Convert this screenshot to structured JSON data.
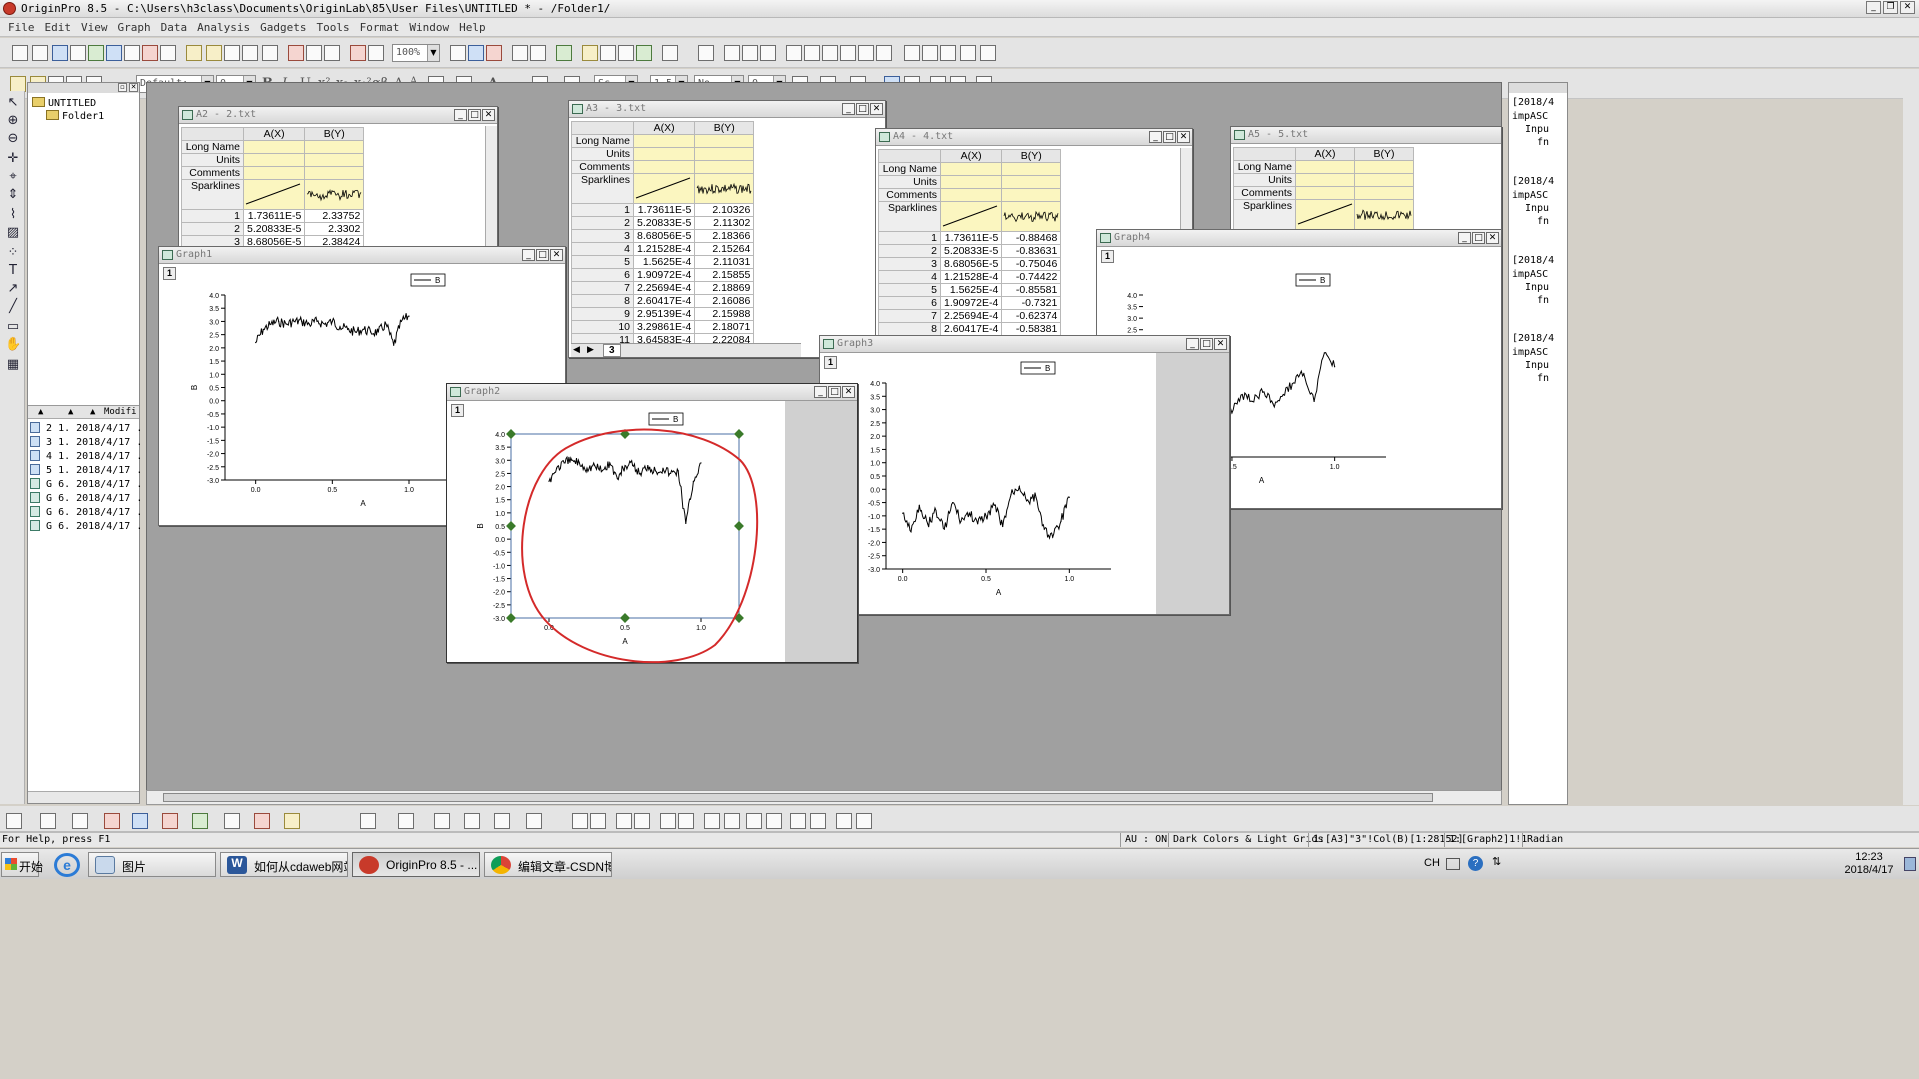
{
  "app": {
    "title": "OriginPro 8.5 - C:\\Users\\h3class\\Documents\\OriginLab\\85\\User Files\\UNTITLED * - /Folder1/"
  },
  "menu": [
    "File",
    "Edit",
    "View",
    "Graph",
    "Data",
    "Analysis",
    "Gadgets",
    "Tools",
    "Format",
    "Window",
    "Help"
  ],
  "toolbar": {
    "zoom": "100%",
    "font_name": "Default:",
    "font_size": "0",
    "bold": "B",
    "italic": "I",
    "underline": "U",
    "superscript": "x²",
    "subscript": "x₂",
    "supersub": "x₁²",
    "greek": "αβ",
    "larger_font": "A",
    "smaller_font": "A",
    "text_color": "A",
    "line_style": "Sc",
    "line_width": "1.5",
    "pattern": "No",
    "pattern_size": "0"
  },
  "explorer": {
    "root": "UNTITLED",
    "folder": "Folder1",
    "columns": {
      "modified": "Modifi"
    },
    "files": [
      {
        "type": "book",
        "id": "2",
        "view": "1.",
        "date": "2018/4/17 ."
      },
      {
        "type": "book",
        "id": "3",
        "view": "1.",
        "date": "2018/4/17 ."
      },
      {
        "type": "book",
        "id": "4",
        "view": "1.",
        "date": "2018/4/17 ."
      },
      {
        "type": "book",
        "id": "5",
        "view": "1.",
        "date": "2018/4/17 ."
      },
      {
        "type": "graph",
        "id": "G",
        "view": "6.",
        "date": "2018/4/17 ."
      },
      {
        "type": "graph",
        "id": "G",
        "view": "6.",
        "date": "2018/4/17 ."
      },
      {
        "type": "graph",
        "id": "G",
        "view": "6.",
        "date": "2018/4/17 ."
      },
      {
        "type": "graph",
        "id": "G",
        "view": "6.",
        "date": "2018/4/17 ."
      }
    ]
  },
  "sheet_labels": {
    "col_a": "A(X)",
    "col_b": "B(Y)",
    "long_name": "Long Name",
    "units": "Units",
    "comments": "Comments",
    "sparklines": "Sparklines"
  },
  "worksheets": {
    "a2": {
      "title": "A2 - 2.txt",
      "rows": [
        {
          "n": "1",
          "a": "1.73611E-5",
          "b": "2.33752"
        },
        {
          "n": "2",
          "a": "5.20833E-5",
          "b": "2.3302"
        },
        {
          "n": "3",
          "a": "8.68056E-5",
          "b": "2.38424"
        }
      ]
    },
    "a3": {
      "title": "A3 - 3.txt",
      "sheet_tab": "3",
      "rows": [
        {
          "n": "1",
          "a": "1.73611E-5",
          "b": "2.10326"
        },
        {
          "n": "2",
          "a": "5.20833E-5",
          "b": "2.11302"
        },
        {
          "n": "3",
          "a": "8.68056E-5",
          "b": "2.18366"
        },
        {
          "n": "4",
          "a": "1.21528E-4",
          "b": "2.15264"
        },
        {
          "n": "5",
          "a": "1.5625E-4",
          "b": "2.11031"
        },
        {
          "n": "6",
          "a": "1.90972E-4",
          "b": "2.15855"
        },
        {
          "n": "7",
          "a": "2.25694E-4",
          "b": "2.18869"
        },
        {
          "n": "8",
          "a": "2.60417E-4",
          "b": "2.16086"
        },
        {
          "n": "9",
          "a": "2.95139E-4",
          "b": "2.15988"
        },
        {
          "n": "10",
          "a": "3.29861E-4",
          "b": "2.18071"
        },
        {
          "n": "11",
          "a": "3.64583E-4",
          "b": "2.22084"
        }
      ]
    },
    "a4": {
      "title": "A4 - 4.txt",
      "rows": [
        {
          "n": "1",
          "a": "1.73611E-5",
          "b": "-0.88468"
        },
        {
          "n": "2",
          "a": "5.20833E-5",
          "b": "-0.83631"
        },
        {
          "n": "3",
          "a": "8.68056E-5",
          "b": "-0.75046"
        },
        {
          "n": "4",
          "a": "1.21528E-4",
          "b": "-0.74422"
        },
        {
          "n": "5",
          "a": "1.5625E-4",
          "b": "-0.85581"
        },
        {
          "n": "6",
          "a": "1.90972E-4",
          "b": "-0.7321"
        },
        {
          "n": "7",
          "a": "2.25694E-4",
          "b": "-0.62374"
        },
        {
          "n": "8",
          "a": "2.60417E-4",
          "b": "-0.58381"
        }
      ]
    },
    "a5": {
      "title": "A5 - 5.txt",
      "rows": []
    }
  },
  "graphs": {
    "graph1": {
      "title": "Graph1",
      "layer": "1",
      "legend": "B",
      "xlabel": "A",
      "ylabel": "B"
    },
    "graph2": {
      "title": "Graph2",
      "layer": "1",
      "legend": "B",
      "xlabel": "A",
      "ylabel": "B"
    },
    "graph3": {
      "title": "Graph3",
      "layer": "1",
      "legend": "B",
      "xlabel": "A",
      "ylabel": "B"
    },
    "graph4": {
      "title": "Graph4",
      "layer": "1",
      "legend": "B",
      "xlabel": "A",
      "ylabel": "B"
    }
  },
  "chart_data": [
    {
      "name": "Graph1",
      "type": "line",
      "xlim": [
        -0.2,
        1.6
      ],
      "ylim": [
        -3.0,
        4.0
      ],
      "xticks": [
        "0.0",
        "0.5",
        "1.0"
      ],
      "yticks": [
        "-3.0",
        "-2.5",
        "-2.0",
        "-1.5",
        "-1.0",
        "-0.5",
        "0.0",
        "0.5",
        "1.0",
        "1.5",
        "2.0",
        "2.5",
        "3.0",
        "3.5",
        "4.0"
      ],
      "x": [
        0.0,
        0.05,
        0.1,
        0.15,
        0.2,
        0.25,
        0.3,
        0.35,
        0.4,
        0.45,
        0.5,
        0.55,
        0.6,
        0.65,
        0.7,
        0.75,
        0.8,
        0.85,
        0.9,
        0.95,
        1.0
      ],
      "y": [
        2.2,
        2.7,
        2.9,
        3.0,
        2.9,
        3.0,
        3.0,
        2.9,
        3.0,
        2.9,
        3.0,
        2.8,
        2.7,
        2.6,
        2.7,
        2.6,
        2.6,
        2.9,
        2.1,
        3.0,
        3.2
      ]
    },
    {
      "name": "Graph2",
      "type": "line",
      "xlim": [
        -0.25,
        1.25
      ],
      "ylim": [
        -3.0,
        4.0
      ],
      "xticks": [
        "0.0",
        "0.5",
        "1.0"
      ],
      "yticks": [
        "-3.0",
        "-2.5",
        "-2.0",
        "-1.5",
        "-1.0",
        "-0.5",
        "0.0",
        "0.5",
        "1.0",
        "1.5",
        "2.0",
        "2.5",
        "3.0",
        "3.5",
        "4.0"
      ],
      "x": [
        0.0,
        0.05,
        0.1,
        0.15,
        0.2,
        0.25,
        0.3,
        0.35,
        0.4,
        0.45,
        0.5,
        0.55,
        0.6,
        0.65,
        0.7,
        0.75,
        0.8,
        0.85,
        0.9,
        0.95,
        1.0
      ],
      "y": [
        2.2,
        2.7,
        2.9,
        3.0,
        2.9,
        2.7,
        2.8,
        2.6,
        2.9,
        2.3,
        2.8,
        2.8,
        2.5,
        2.8,
        2.6,
        2.7,
        2.5,
        2.6,
        0.6,
        2.2,
        2.9
      ]
    },
    {
      "name": "Graph3",
      "type": "line",
      "xlim": [
        -0.1,
        1.25
      ],
      "ylim": [
        -3.0,
        4.0
      ],
      "xticks": [
        "0.0",
        "0.5",
        "1.0"
      ],
      "yticks": [
        "-3.0",
        "-2.5",
        "-2.0",
        "-1.5",
        "-1.0",
        "-0.5",
        "0.0",
        "0.5",
        "1.0",
        "1.5",
        "2.0",
        "2.5",
        "3.0",
        "3.5",
        "4.0"
      ],
      "x": [
        0.0,
        0.05,
        0.1,
        0.15,
        0.2,
        0.25,
        0.3,
        0.35,
        0.4,
        0.45,
        0.5,
        0.55,
        0.6,
        0.65,
        0.7,
        0.75,
        0.8,
        0.85,
        0.9,
        0.95,
        1.0
      ],
      "y": [
        -0.9,
        -1.6,
        -0.6,
        -1.3,
        -0.8,
        -1.5,
        -0.5,
        -1.2,
        -0.9,
        -1.3,
        -1.0,
        -0.6,
        -1.4,
        -0.2,
        0.1,
        -0.4,
        -0.3,
        -1.5,
        -1.8,
        -1.2,
        -0.3
      ]
    },
    {
      "name": "Graph4",
      "type": "line",
      "xlim": [
        -0.6,
        1.25
      ],
      "ylim": [
        -3.0,
        4.0
      ],
      "xticks": [
        "0.5",
        "1.0"
      ],
      "yticks": [
        "2.0",
        "2.5",
        "3.0",
        "3.5",
        "4.0"
      ],
      "x": [
        0.0,
        0.05,
        0.1,
        0.15,
        0.2,
        0.25,
        0.3,
        0.35,
        0.4,
        0.45,
        0.5,
        0.55,
        0.6,
        0.65,
        0.7,
        0.75,
        0.8,
        0.85,
        0.9,
        0.95,
        1.0
      ],
      "y": [
        0.8,
        0.3,
        0.0,
        -0.4,
        0.2,
        -0.6,
        -0.2,
        -0.9,
        -0.5,
        -0.4,
        -1.1,
        -0.3,
        -0.6,
        -0.2,
        -0.7,
        -0.3,
        0.2,
        0.6,
        -0.6,
        1.5,
        0.9
      ]
    }
  ],
  "results_log": [
    {
      "l1": "[2018/4",
      "l2": "impASC",
      "l3": "Inpu",
      "l4": "fn"
    },
    {
      "l1": "[2018/4",
      "l2": "impASC",
      "l3": "Inpu",
      "l4": "fn"
    },
    {
      "l1": "[2018/4",
      "l2": "impASC",
      "l3": "Inpu",
      "l4": "fn"
    },
    {
      "l1": "[2018/4",
      "l2": "impASC",
      "l3": "Inpu",
      "l4": "fn"
    }
  ],
  "status": {
    "help": "For Help, press F1",
    "au": "AU : ON",
    "theme": "Dark Colors & Light Grids",
    "cell": "1:[A3]\"3\"!Col(B)[1:28152]",
    "layer": "1:[Graph2]1!1",
    "angle": "Radian"
  },
  "taskbar": {
    "start": "开始",
    "items": [
      "图片",
      "如何从cdaweb网站...",
      "OriginPro 8.5 - ...",
      "编辑文章-CSDN博..."
    ],
    "ime": "CH",
    "time": "12:23",
    "date": "2018/4/17"
  },
  "colors": {
    "annotation": "#d42a2a",
    "selection": "#3a7a2a",
    "sheet_meta": "#fbf6c0"
  }
}
